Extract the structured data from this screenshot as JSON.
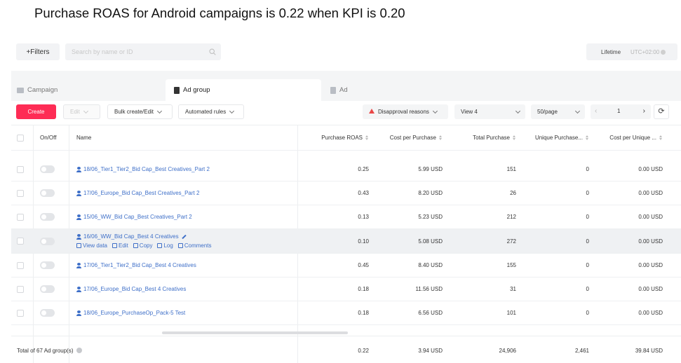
{
  "headline": "Purchase ROAS for Android campaigns is 0.22 when KPI is 0.20",
  "topbar": {
    "filters_label": "+Filters",
    "search_placeholder": "Search by name or ID",
    "date_range_label": "Lifetime",
    "timezone": "UTC+02:00"
  },
  "tabs": [
    {
      "label": "Campaign",
      "icon": "campaign-icon",
      "active": false
    },
    {
      "label": "Ad group",
      "icon": "ad-group-icon",
      "active": true
    },
    {
      "label": "Ad",
      "icon": "ad-icon",
      "active": false
    }
  ],
  "toolbar": {
    "create_label": "Create",
    "edit_label": "Edit",
    "bulk_label": "Bulk create/Edit",
    "automated_label": "Automated rules",
    "disapproval_label": "Disapproval reasons",
    "view_label": "View 4",
    "per_page_label": "50/page",
    "page_number": "1"
  },
  "columns": {
    "onoff": "On/Off",
    "name": "Name",
    "roas": "Purchase ROAS",
    "cpp": "Cost per Purchase",
    "tp": "Total Purchase",
    "up": "Unique Purchase...",
    "cpu": "Cost per Unique ..."
  },
  "rows": [
    {
      "name": "18/06_Tier1_Tier2_Bid Cap_Best Creatives_Part 2",
      "roas": "0.25",
      "cpp": "5.99 USD",
      "tp": "151",
      "up": "0",
      "cpu": "0.00 USD"
    },
    {
      "name": "17/06_Europe_Bid Cap_Best Creatives_Part 2",
      "roas": "0.43",
      "cpp": "8.20 USD",
      "tp": "26",
      "up": "0",
      "cpu": "0.00 USD"
    },
    {
      "name": "15/06_WW_Bid Cap_Best Creatives_Part 2",
      "roas": "0.13",
      "cpp": "5.23 USD",
      "tp": "212",
      "up": "0",
      "cpu": "0.00 USD"
    },
    {
      "name": "16/06_WW_Bid Cap_Best 4 Creatives",
      "roas": "0.10",
      "cpp": "5.08 USD",
      "tp": "272",
      "up": "0",
      "cpu": "0.00 USD"
    },
    {
      "name": "17/06_Tier1_Tier2_Bid Cap_Best 4 Creatives",
      "roas": "0.45",
      "cpp": "8.40 USD",
      "tp": "155",
      "up": "0",
      "cpu": "0.00 USD"
    },
    {
      "name": "17/06_Europe_Bid Cap_Best 4 Creatives",
      "roas": "0.18",
      "cpp": "11.56 USD",
      "tp": "31",
      "up": "0",
      "cpu": "0.00 USD"
    },
    {
      "name": "18/06_Europe_PurchaseOp_Pack-5 Test",
      "roas": "0.18",
      "cpp": "6.56 USD",
      "tp": "101",
      "up": "0",
      "cpu": "0.00 USD"
    }
  ],
  "hover_actions": {
    "view_data": "View data",
    "edit": "Edit",
    "copy": "Copy",
    "log": "Log",
    "comments": "Comments"
  },
  "footer": {
    "total_label": "Total of 67 Ad group(s)",
    "roas": "0.22",
    "cpp": "3.94 USD",
    "tp": "24,906",
    "up": "2,461",
    "cpu": "39.84 USD"
  }
}
